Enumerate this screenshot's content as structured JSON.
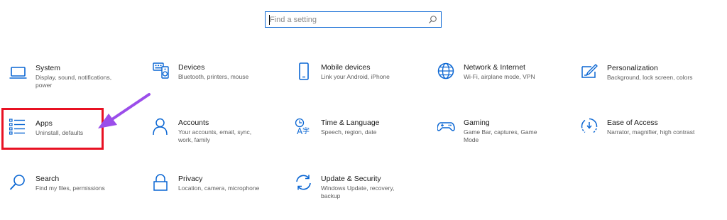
{
  "search": {
    "placeholder": "Find a setting",
    "icon": "search-icon"
  },
  "tiles": [
    {
      "title": "System",
      "desc": "Display, sound, notifications, power",
      "icon": "laptop-icon"
    },
    {
      "title": "Devices",
      "desc": "Bluetooth, printers, mouse",
      "icon": "keyboard-speaker-icon"
    },
    {
      "title": "Mobile devices",
      "desc": "Link your Android, iPhone",
      "icon": "phone-icon"
    },
    {
      "title": "Network & Internet",
      "desc": "Wi-Fi, airplane mode, VPN",
      "icon": "globe-icon"
    },
    {
      "title": "Personalization",
      "desc": "Background, lock screen, colors",
      "icon": "paintbrush-icon"
    },
    {
      "title": "Apps",
      "desc": "Uninstall, defaults",
      "icon": "apps-list-icon"
    },
    {
      "title": "Accounts",
      "desc": "Your accounts, email, sync, work, family",
      "icon": "person-icon"
    },
    {
      "title": "Time & Language",
      "desc": "Speech, region, date",
      "icon": "time-language-icon"
    },
    {
      "title": "Gaming",
      "desc": "Game Bar, captures, Game Mode",
      "icon": "gamepad-icon"
    },
    {
      "title": "Ease of Access",
      "desc": "Narrator, magnifier, high contrast",
      "icon": "ease-of-access-icon"
    },
    {
      "title": "Search",
      "desc": "Find my files, permissions",
      "icon": "magnifier-icon"
    },
    {
      "title": "Privacy",
      "desc": "Location, camera, microphone",
      "icon": "lock-icon"
    },
    {
      "title": "Update & Security",
      "desc": "Windows Update, recovery, backup",
      "icon": "sync-arrows-icon"
    }
  ],
  "colors": {
    "accent": "#0a66d3",
    "highlight_box": "#e81123",
    "annotation_arrow": "#9b4dea"
  }
}
